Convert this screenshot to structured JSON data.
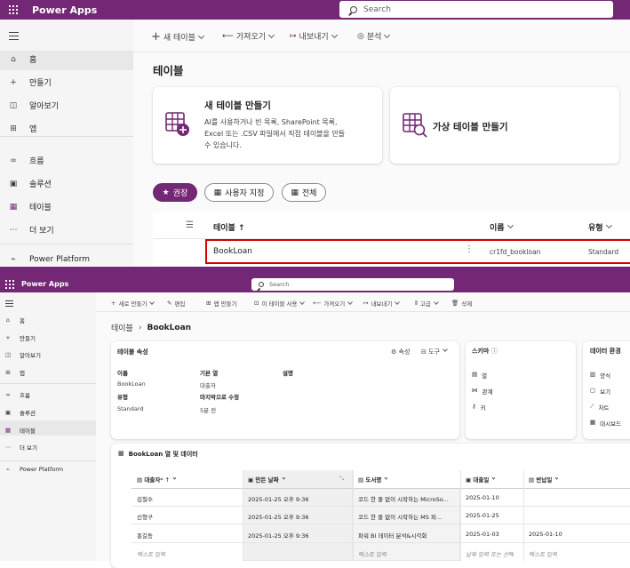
{
  "top": {
    "app_title": "Power Apps",
    "search_placeholder": "Search",
    "toolbar": {
      "new_table": "새 테이블",
      "import": "가져오기",
      "export": "내보내기",
      "analyze": "분석"
    },
    "nav": [
      {
        "label": "홈",
        "icon": "home-icon"
      },
      {
        "label": "만들기",
        "icon": "plus-icon"
      },
      {
        "label": "알아보기",
        "icon": "book-icon"
      },
      {
        "label": "앱",
        "icon": "apps-icon"
      },
      {
        "label": "흐름",
        "icon": "flow-icon"
      },
      {
        "label": "솔루션",
        "icon": "solution-icon"
      },
      {
        "label": "테이블",
        "icon": "table-icon"
      },
      {
        "label": "더 보기",
        "icon": "more-icon"
      },
      {
        "label": "Power Platform",
        "icon": "power-platform-icon"
      }
    ],
    "page_title": "테이블",
    "cards": {
      "new_title": "새 테이블 만들기",
      "new_desc_1": "AI를 사용하거나 빈 목록, SharePoint 목록,",
      "new_desc_2": "Excel 또는 .CSV 파일에서 직접 테이블을 만들",
      "new_desc_3": "수 있습니다.",
      "virtual_title": "가상 테이블 만들기"
    },
    "filters": {
      "recommended": "권장",
      "custom": "사용자 지정",
      "all": "전체"
    },
    "columns": {
      "table": "테이블 ↑",
      "name": "이름",
      "type": "유형"
    },
    "row": {
      "table": "BookLoan",
      "name": "cr1fd_bookloan",
      "type": "Standard"
    }
  },
  "bottom": {
    "app_title": "Power Apps",
    "search_placeholder": "Search",
    "toolbar": [
      "새로 만들기",
      "편집",
      "앱 만들기",
      "이 테이블 사용",
      "가져오기",
      "내보내기",
      "고급",
      "삭제"
    ],
    "nav": [
      {
        "label": "홈",
        "icon": "home-icon"
      },
      {
        "label": "만들기",
        "icon": "plus-icon"
      },
      {
        "label": "알아보기",
        "icon": "book-icon"
      },
      {
        "label": "앱",
        "icon": "apps-icon"
      },
      {
        "label": "흐름",
        "icon": "flow-icon"
      },
      {
        "label": "솔루션",
        "icon": "solution-icon"
      },
      {
        "label": "테이블",
        "icon": "table-icon"
      },
      {
        "label": "더 보기",
        "icon": "more-icon"
      },
      {
        "label": "Power Platform",
        "icon": "power-platform-icon"
      }
    ],
    "breadcrumb": {
      "parent": "테이블",
      "current": "BookLoan"
    },
    "props": {
      "title": "테이블 속성",
      "props_btn": "속성",
      "tools_btn": "도구",
      "name_label": "이름",
      "name_value": "BookLoan",
      "primary_label": "기본 열",
      "primary_value": "대출자",
      "desc_label": "설명",
      "type_label": "유형",
      "type_value": "Standard",
      "modified_label": "마지막으로 수정",
      "modified_value": "5분 전"
    },
    "schema": {
      "title": "스키마",
      "items": [
        "열",
        "관계",
        "키"
      ]
    },
    "data_exp": {
      "title": "데이터 환경",
      "items": [
        "양식",
        "보기",
        "차트",
        "대시보드"
      ]
    },
    "grid": {
      "title": "BookLoan 열 및 데이터",
      "headers": [
        "대출자",
        "만든 날짜",
        "도서명",
        "대출일",
        "반납일"
      ],
      "rows": [
        [
          "김철수",
          "2025-01-25 오후 9:36",
          "코드 한 줄 없이 시작하는 MicroSo...",
          "2025-01-10",
          ""
        ],
        [
          "신형구",
          "2025-01-25 오후 9:36",
          "코드 한 줄 없이 시작하는 MS 파...",
          "2025-01-25",
          ""
        ],
        [
          "홍길동",
          "2025-01-25 오후 9:36",
          "파워 BI 데이터 분석&시각화",
          "2025-01-03",
          "2025-01-10"
        ]
      ],
      "placeholders": [
        "텍스트 입력",
        "",
        "텍스트 입력",
        "날짜 입력 또는 선택",
        "텍스트 입력"
      ]
    }
  },
  "colors": {
    "brand": "#742774",
    "accent": "#742774",
    "highlight_border": "#d40000",
    "sidebar_bg": "#f5f5f5"
  }
}
